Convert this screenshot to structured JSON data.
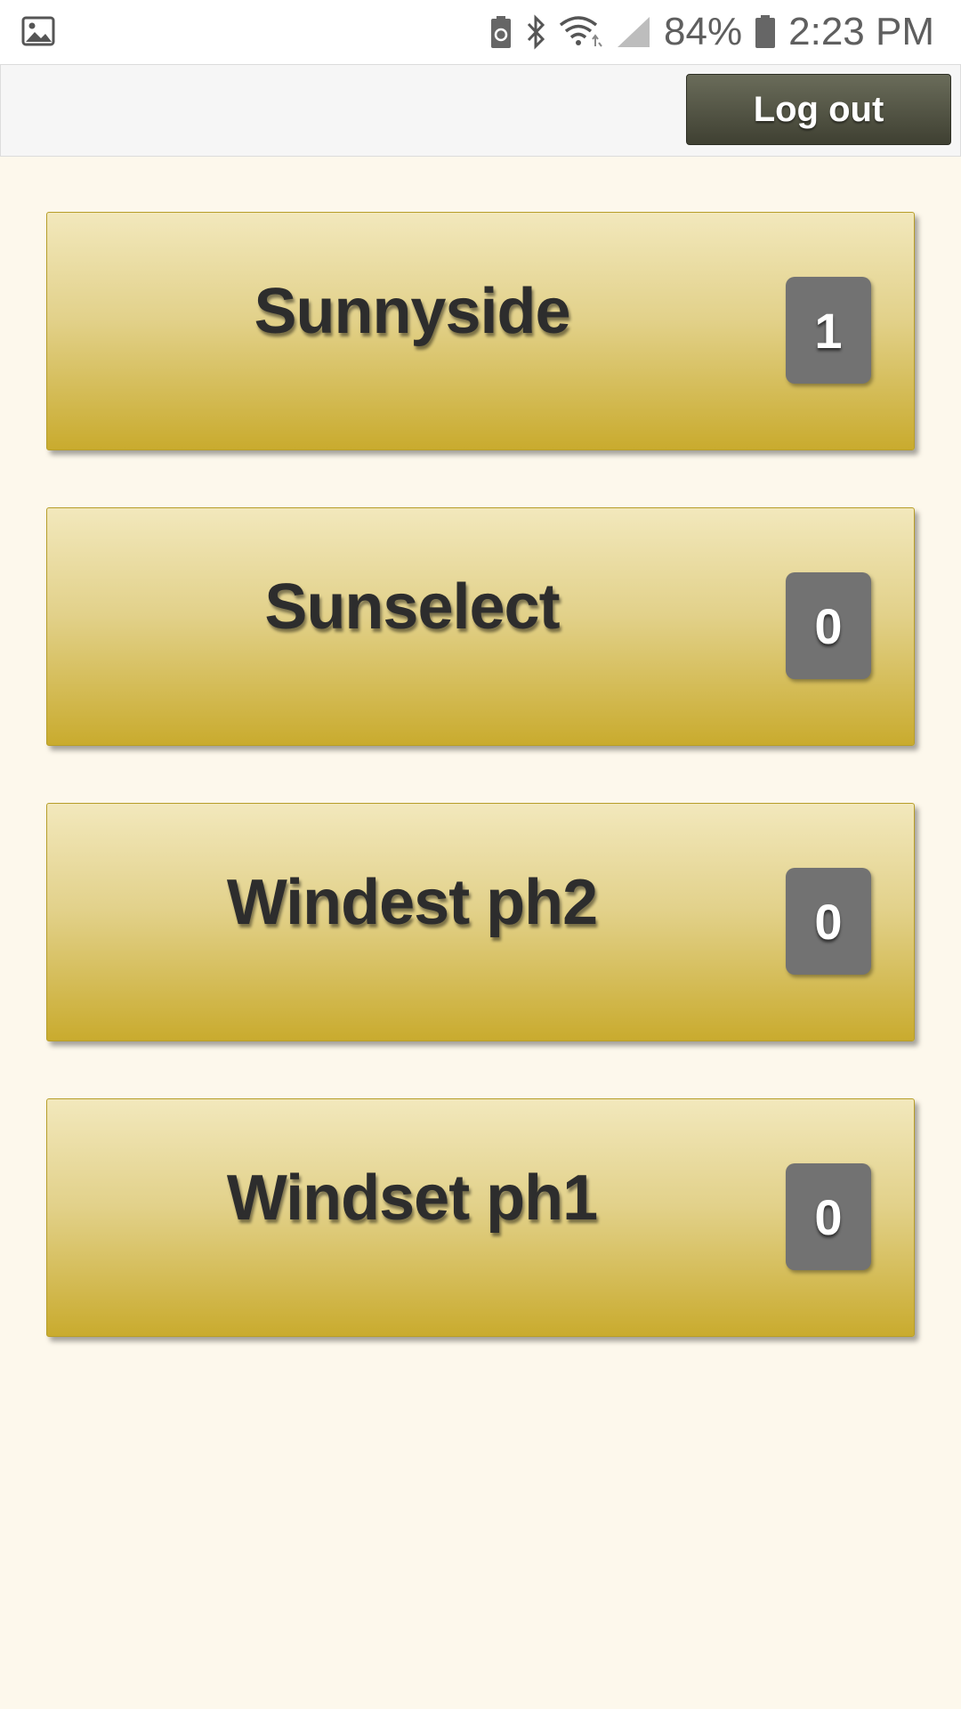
{
  "status_bar": {
    "battery_percent": "84%",
    "time": "2:23 PM",
    "icons": [
      "image-icon",
      "battery-saver-icon",
      "bluetooth-icon",
      "wifi-icon",
      "signal-icon",
      "battery-icon"
    ]
  },
  "header": {
    "logout_label": "Log out"
  },
  "sites": [
    {
      "name": "Sunnyside",
      "count": "1"
    },
    {
      "name": "Sunselect",
      "count": "0"
    },
    {
      "name": "Windest ph2",
      "count": "0"
    },
    {
      "name": "Windset ph1",
      "count": "0"
    }
  ],
  "colors": {
    "page_background": "#fdf8ec",
    "card_gradient_top": "#f2e8bc",
    "card_gradient_bottom": "#c9ab2e",
    "badge": "#727272",
    "logout_button": "#4f5142"
  }
}
